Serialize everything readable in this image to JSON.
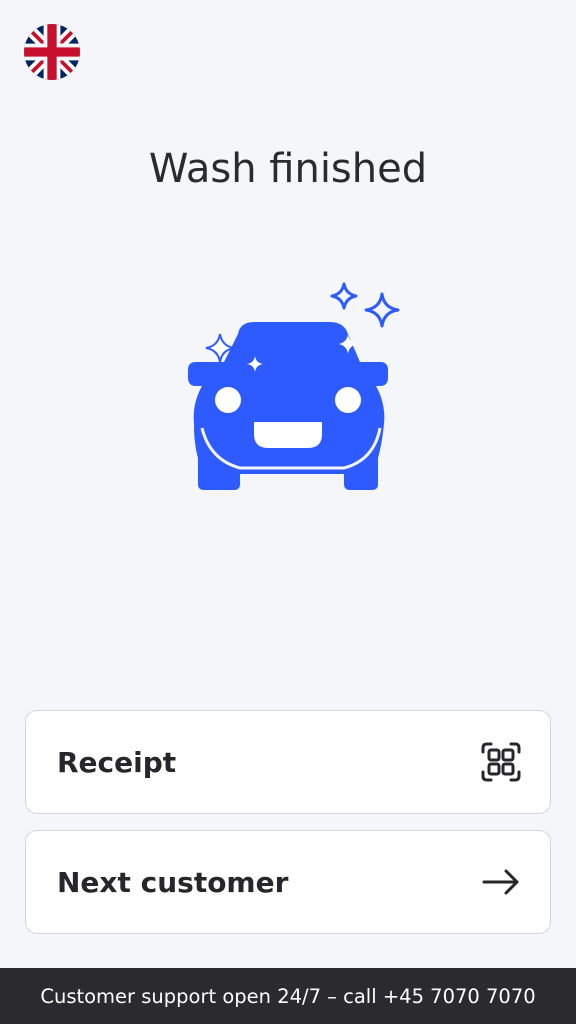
{
  "header": {
    "language_flag_icon": "uk-flag-icon",
    "title": "Wash finished"
  },
  "illustration": {
    "icon": "happy-sparkling-car-icon",
    "color": "#2d5bff"
  },
  "actions": {
    "receipt": {
      "label": "Receipt",
      "icon": "qr-code-icon"
    },
    "next_customer": {
      "label": "Next customer",
      "icon": "arrow-right-icon"
    }
  },
  "footer": {
    "support_text": "Customer support open 24/7 – call +45 7070 7070"
  },
  "colors": {
    "background": "#f4f6fa",
    "accent": "#2d5bff",
    "footer_bg": "#2b2b2f",
    "text": "#26262b"
  }
}
